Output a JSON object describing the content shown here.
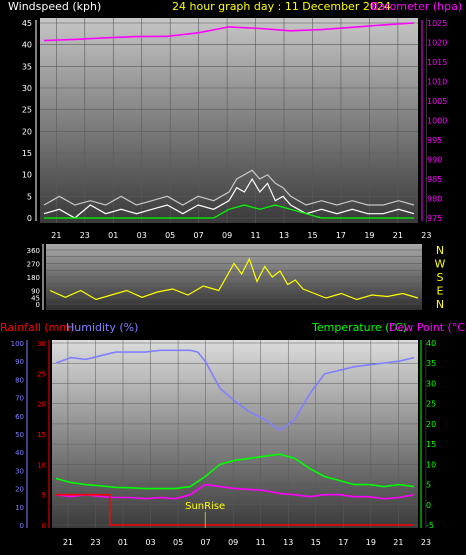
{
  "header": {
    "title": "24 hour graph day : 11 December 2024",
    "wind_label": "Windspeed (kph)",
    "baro_label": "Barometer (hpa)"
  },
  "colors": {
    "windspeed": "#ffffff",
    "gust_fill": "#c8c8c8",
    "direction": "#ffff00",
    "barometer": "#ff00ff",
    "temperature": "#00ff00",
    "dewpoint": "#ff00ff",
    "humidity": "#8080ff",
    "rainfall": "#ff0000",
    "title": "#ffff00"
  },
  "bottom_labels": {
    "rain": "Rainfall (mm)",
    "humidity": "Humidity (%)",
    "temperature": "Temperature (°C)",
    "dewpoint": "Dew Point (°C)",
    "sunrise": "SunRise"
  },
  "chart_data": [
    {
      "type": "line",
      "x_ticks": [
        "21",
        "23",
        "01",
        "03",
        "05",
        "07",
        "09",
        "11",
        "13",
        "15",
        "17",
        "19",
        "21",
        "23"
      ],
      "left_axis": {
        "label": "Windspeed (kph)",
        "ylim": [
          0,
          45
        ],
        "ticks": [
          0,
          5,
          10,
          15,
          20,
          25,
          30,
          35,
          40,
          45
        ]
      },
      "right_axis": {
        "label": "Barometer (hpa)",
        "ylim": [
          975,
          1025
        ],
        "ticks": [
          975,
          980,
          985,
          990,
          995,
          1000,
          1005,
          1010,
          1015,
          1020,
          1025
        ]
      },
      "series": [
        {
          "name": "Barometer (hpa)",
          "axis": "right",
          "x": [
            0,
            2,
            4,
            6,
            8,
            10,
            12,
            14,
            16,
            18,
            20,
            22,
            24
          ],
          "values": [
            1020.5,
            1020.8,
            1021.2,
            1021.5,
            1021.6,
            1022.5,
            1024,
            1023.6,
            1023.0,
            1023.3,
            1023.9,
            1024.5,
            1025.0
          ]
        },
        {
          "name": "Windspeed (kph)",
          "axis": "left",
          "x": [
            0,
            1,
            2,
            3,
            4,
            5,
            6,
            7,
            8,
            9,
            10,
            11,
            12,
            12.5,
            13,
            13.5,
            14,
            14.5,
            15,
            15.5,
            16,
            16.5,
            17,
            18,
            19,
            20,
            21,
            22,
            23,
            24
          ],
          "values": [
            1,
            2,
            0,
            3,
            1,
            2,
            1,
            2,
            3,
            1,
            3,
            2,
            4,
            7,
            6,
            9,
            6,
            8,
            4,
            5,
            3,
            2,
            1,
            2,
            1,
            2,
            1,
            1,
            2,
            1
          ]
        },
        {
          "name": "Gust (kph)",
          "axis": "left",
          "x": [
            0,
            1,
            2,
            3,
            4,
            5,
            6,
            7,
            8,
            9,
            10,
            11,
            12,
            12.5,
            13,
            13.5,
            14,
            14.5,
            15,
            15.5,
            16,
            16.5,
            17,
            18,
            19,
            20,
            21,
            22,
            23,
            24
          ],
          "values": [
            3,
            5,
            3,
            4,
            3,
            5,
            3,
            4,
            5,
            3,
            5,
            4,
            6,
            9,
            10,
            11,
            9,
            10,
            8,
            7,
            5,
            4,
            3,
            4,
            3,
            4,
            3,
            3,
            4,
            3
          ]
        },
        {
          "name": "Windspeed (green)",
          "axis": "left",
          "x": [
            0,
            2,
            4,
            6,
            8,
            10,
            11,
            12,
            13,
            14,
            15,
            16,
            17,
            18,
            20,
            22,
            24
          ],
          "values": [
            0,
            0,
            0,
            0,
            0,
            0,
            0,
            2,
            3,
            2,
            3,
            2,
            1,
            0,
            0,
            0,
            0
          ]
        }
      ]
    },
    {
      "type": "scatter",
      "x_ticks": [],
      "y_axis": {
        "ylim": [
          0,
          360
        ],
        "ticks": [
          0,
          45,
          90,
          135,
          180,
          225,
          270,
          315,
          360
        ]
      },
      "compass": [
        "N",
        "W",
        "S",
        "E",
        "N"
      ],
      "series": [
        {
          "name": "Wind direction",
          "x": [
            0,
            1,
            2,
            3,
            4,
            5,
            6,
            7,
            8,
            9,
            10,
            11,
            12,
            12.5,
            13,
            13.5,
            14,
            14.5,
            15,
            15.5,
            16,
            16.5,
            17,
            18,
            19,
            20,
            21,
            22,
            23,
            24
          ],
          "values": [
            90,
            45,
            90,
            30,
            60,
            90,
            45,
            80,
            100,
            60,
            120,
            90,
            270,
            200,
            300,
            150,
            250,
            180,
            220,
            130,
            160,
            100,
            80,
            40,
            70,
            30,
            60,
            50,
            70,
            40
          ]
        }
      ]
    },
    {
      "type": "line",
      "x_ticks": [
        "21",
        "23",
        "01",
        "03",
        "05",
        "07",
        "09",
        "11",
        "13",
        "15",
        "17",
        "19",
        "21",
        "23"
      ],
      "axes": {
        "humidity": {
          "ylim": [
            0,
            100
          ],
          "ticks": [
            0,
            10,
            20,
            30,
            40,
            50,
            60,
            70,
            80,
            90,
            100
          ]
        },
        "rainfall": {
          "ylim": [
            0,
            30
          ],
          "ticks": [
            0,
            5,
            10,
            15,
            20,
            25,
            30
          ]
        },
        "temperature": {
          "ylim": [
            -5,
            40
          ],
          "ticks": [
            -5,
            0,
            5,
            10,
            15,
            20,
            25,
            30,
            35,
            40
          ]
        }
      },
      "series": [
        {
          "name": "Humidity (%)",
          "axis": "humidity",
          "x": [
            0,
            1,
            2,
            3,
            4,
            5,
            6,
            7,
            8,
            9,
            9.5,
            10,
            11,
            12,
            13,
            14,
            15,
            16,
            17,
            18,
            19,
            20,
            21,
            22,
            23,
            24
          ],
          "values": [
            89,
            92,
            91,
            93,
            95,
            95,
            95,
            96,
            96,
            96,
            95,
            90,
            75,
            68,
            62,
            58,
            52,
            58,
            72,
            83,
            85,
            87,
            88,
            89,
            90,
            92
          ]
        },
        {
          "name": "Temperature (°C)",
          "axis": "temperature",
          "x": [
            0,
            1,
            2,
            3,
            4,
            5,
            6,
            7,
            8,
            9,
            10,
            11,
            12,
            13,
            14,
            15,
            16,
            17,
            18,
            19,
            20,
            21,
            22,
            23,
            24
          ],
          "values": [
            6.5,
            5.5,
            5,
            4.7,
            4.3,
            4.2,
            4.0,
            4.0,
            4.0,
            4.5,
            7,
            10,
            11,
            11.5,
            12,
            12.5,
            11.5,
            9,
            7,
            6,
            5,
            5,
            4.5,
            5.0,
            4.5
          ]
        },
        {
          "name": "Dew Point (°C)",
          "axis": "temperature",
          "x": [
            0,
            1,
            2,
            3,
            4,
            5,
            6,
            7,
            8,
            9,
            10,
            11,
            12,
            13,
            14,
            15,
            16,
            17,
            18,
            19,
            20,
            21,
            22,
            23,
            24
          ],
          "values": [
            2.5,
            2,
            2.5,
            2,
            1.8,
            1.8,
            1.5,
            1.8,
            1.5,
            2.5,
            5,
            4.5,
            4,
            3.8,
            3.5,
            2.8,
            2.5,
            2,
            2.5,
            2.5,
            2,
            2,
            1.5,
            1.8,
            2.5
          ]
        },
        {
          "name": "Rainfall (mm)",
          "axis": "rainfall",
          "x": [
            0,
            1,
            2,
            3,
            3.6,
            3.6,
            4,
            6,
            8,
            10,
            12,
            14,
            16,
            18,
            20,
            22,
            24
          ],
          "values": [
            5,
            5,
            5,
            5,
            5,
            0,
            0,
            0,
            0,
            0,
            0,
            0,
            0,
            0,
            0,
            0,
            0
          ]
        }
      ],
      "annotations": [
        {
          "text": "SunRise",
          "x": 10.0
        }
      ]
    }
  ]
}
